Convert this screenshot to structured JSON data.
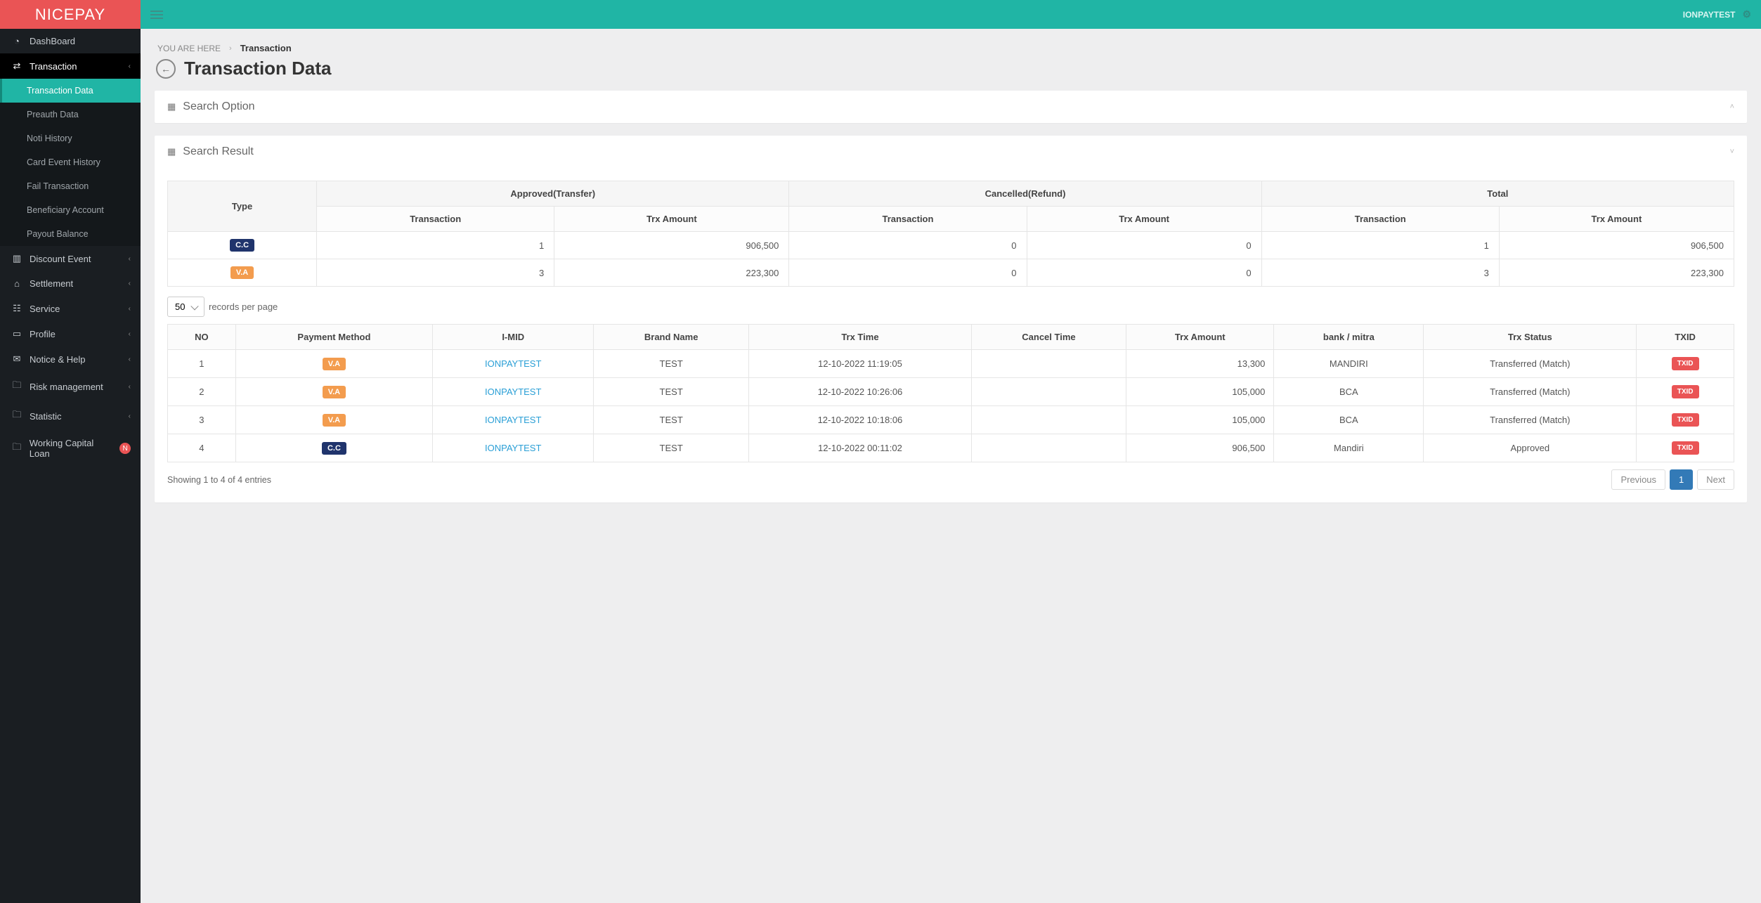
{
  "brand": "NICEPAY",
  "user": "IONPAYTEST",
  "sidebar": {
    "items": [
      {
        "label": "DashBoard",
        "glyph": "◔"
      },
      {
        "label": "Transaction",
        "glyph": "⇄",
        "expanded": true,
        "children": [
          {
            "label": "Transaction Data",
            "active": true
          },
          {
            "label": "Preauth Data"
          },
          {
            "label": "Noti History"
          },
          {
            "label": "Card Event History"
          },
          {
            "label": "Fail Transaction"
          },
          {
            "label": "Beneficiary Account"
          },
          {
            "label": "Payout Balance"
          }
        ]
      },
      {
        "label": "Discount Event",
        "glyph": "▥"
      },
      {
        "label": "Settlement",
        "glyph": "⌂"
      },
      {
        "label": "Service",
        "glyph": "☷"
      },
      {
        "label": "Profile",
        "glyph": "▭"
      },
      {
        "label": "Notice & Help",
        "glyph": "✉"
      },
      {
        "label": "Risk management",
        "glyph": "🗀"
      },
      {
        "label": "Statistic",
        "glyph": "🗀"
      },
      {
        "label": "Working Capital Loan",
        "glyph": "🗀",
        "badge": "N"
      }
    ]
  },
  "breadcrumb": {
    "prefix": "YOU ARE HERE",
    "current": "Transaction"
  },
  "page_title": "Transaction Data",
  "panels": {
    "search_option": "Search Option",
    "search_result": "Search Result"
  },
  "summary": {
    "headers": {
      "type": "Type",
      "approved": "Approved(Transfer)",
      "cancelled": "Cancelled(Refund)",
      "total": "Total",
      "transaction": "Transaction",
      "trx_amount": "Trx Amount"
    },
    "rows": [
      {
        "type": "C.C",
        "type_class": "cc",
        "a_txn": "1",
        "a_amt": "906,500",
        "c_txn": "0",
        "c_amt": "0",
        "t_txn": "1",
        "t_amt": "906,500"
      },
      {
        "type": "V.A",
        "type_class": "va",
        "a_txn": "3",
        "a_amt": "223,300",
        "c_txn": "0",
        "c_amt": "0",
        "t_txn": "3",
        "t_amt": "223,300"
      }
    ]
  },
  "records": {
    "page_size": "50",
    "suffix": "records per page"
  },
  "result": {
    "columns": [
      "NO",
      "Payment Method",
      "I-MID",
      "Brand Name",
      "Trx Time",
      "Cancel Time",
      "Trx Amount",
      "bank / mitra",
      "Trx Status",
      "TXID"
    ],
    "rows": [
      {
        "no": "1",
        "pm": "V.A",
        "pm_class": "va",
        "imid": "IONPAYTEST",
        "brand": "TEST",
        "trx_time": "12-10-2022 11:19:05",
        "cancel_time": "",
        "amt": "13,300",
        "bank": "MANDIRI",
        "status": "Transferred (Match)",
        "txid": "TXID"
      },
      {
        "no": "2",
        "pm": "V.A",
        "pm_class": "va",
        "imid": "IONPAYTEST",
        "brand": "TEST",
        "trx_time": "12-10-2022 10:26:06",
        "cancel_time": "",
        "amt": "105,000",
        "bank": "BCA",
        "status": "Transferred (Match)",
        "txid": "TXID"
      },
      {
        "no": "3",
        "pm": "V.A",
        "pm_class": "va",
        "imid": "IONPAYTEST",
        "brand": "TEST",
        "trx_time": "12-10-2022 10:18:06",
        "cancel_time": "",
        "amt": "105,000",
        "bank": "BCA",
        "status": "Transferred (Match)",
        "txid": "TXID"
      },
      {
        "no": "4",
        "pm": "C.C",
        "pm_class": "cc",
        "imid": "IONPAYTEST",
        "brand": "TEST",
        "trx_time": "12-10-2022 00:11:02",
        "cancel_time": "",
        "amt": "906,500",
        "bank": "Mandiri",
        "status": "Approved",
        "txid": "TXID"
      }
    ]
  },
  "footer": {
    "showing": "Showing 1 to 4 of 4 entries",
    "previous": "Previous",
    "page": "1",
    "next": "Next"
  }
}
